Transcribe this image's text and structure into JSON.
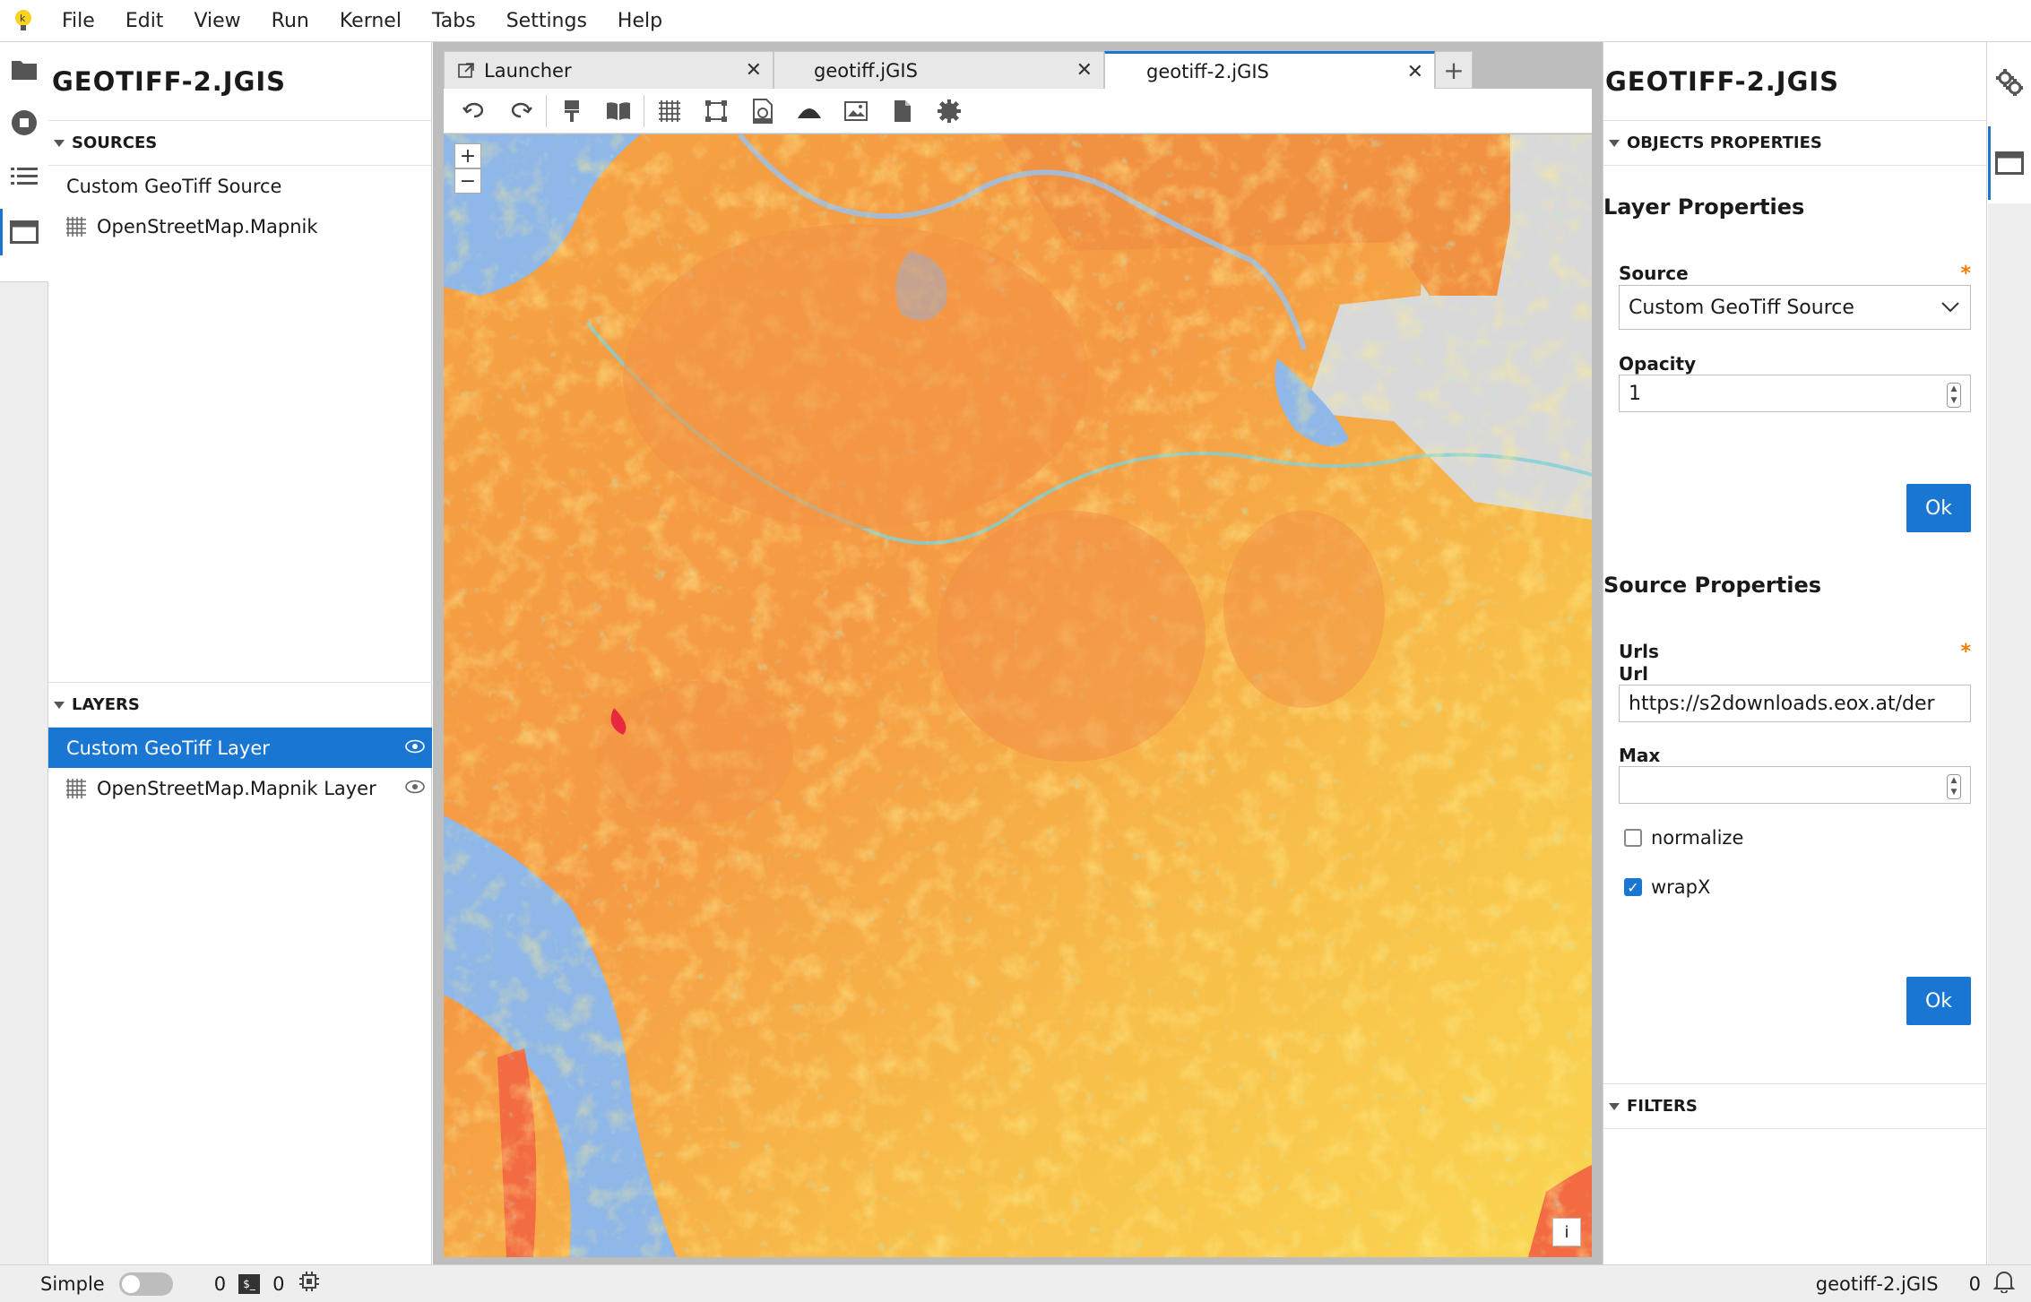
{
  "menu": [
    "File",
    "Edit",
    "View",
    "Run",
    "Kernel",
    "Tabs",
    "Settings",
    "Help"
  ],
  "left_panel": {
    "title": "GEOTIFF-2.JGIS",
    "sources_header": "SOURCES",
    "sources": [
      "Custom GeoTiff Source",
      "OpenStreetMap.Mapnik"
    ],
    "layers_header": "LAYERS",
    "layers": [
      "Custom GeoTiff Layer",
      "OpenStreetMap.Mapnik Layer"
    ]
  },
  "tabs": [
    {
      "label": "Launcher",
      "icon": "launch-icon"
    },
    {
      "label": "geotiff.jGIS"
    },
    {
      "label": "geotiff-2.jGIS",
      "active": true
    }
  ],
  "toolbar_icons": [
    "undo-icon",
    "redo-icon",
    "paint-icon",
    "book-icon",
    "grid-icon",
    "vector-icon",
    "geojson-icon",
    "hillshade-icon",
    "image-icon",
    "file-icon",
    "gear-icon"
  ],
  "map": {
    "zoom_in": "+",
    "zoom_out": "−",
    "info": "i"
  },
  "right_panel": {
    "title": "GEOTIFF-2.JGIS",
    "objects_header": "OBJECTS PROPERTIES",
    "layer_properties": "Layer Properties",
    "source_label": "Source",
    "source_value": "Custom GeoTiff Source",
    "opacity_label": "Opacity",
    "opacity_value": "1",
    "ok": "Ok",
    "source_properties": "Source Properties",
    "urls_label": "Urls",
    "url_label": "Url",
    "url_value": "https://s2downloads.eox.at/der",
    "max_label": "Max",
    "max_value": "",
    "normalize_label": "normalize",
    "normalize_checked": false,
    "wrapx_label": "wrapX",
    "wrapx_checked": true,
    "filters_header": "FILTERS"
  },
  "status": {
    "mode": "Simple",
    "kernels": "0",
    "terminals": "0",
    "doc_name": "geotiff-2.jGIS",
    "notifications": "0"
  },
  "colors": {
    "accent": "#1976d2",
    "required": "#f57c00"
  }
}
